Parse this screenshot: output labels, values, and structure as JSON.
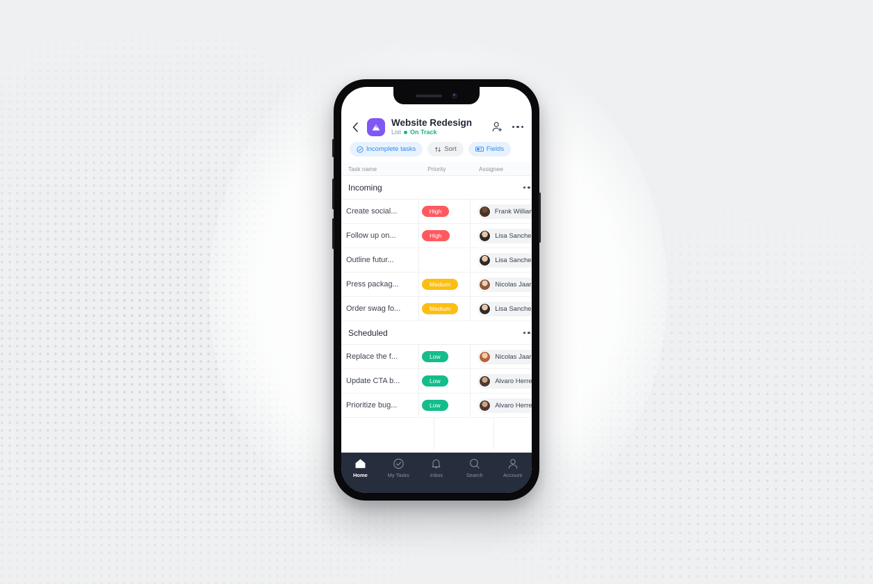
{
  "header": {
    "back_icon": "chevron-left-icon",
    "project_icon": "mountain-app-icon",
    "project_icon_color": "#8057f2",
    "title": "Website Redesign",
    "view_label": "List",
    "separator": "•",
    "status": "On Track",
    "status_color": "#19b57a",
    "invite_icon": "person-add-icon",
    "more_icon": "more-horizontal-icon"
  },
  "toolbar": {
    "chips": [
      {
        "label": "Incomplete tasks",
        "icon": "check-circle-icon",
        "style": "blue"
      },
      {
        "label": "Sort",
        "icon": "sort-arrows-icon",
        "style": "gray"
      },
      {
        "label": "Fields",
        "icon": "fields-icon",
        "style": "blue"
      }
    ]
  },
  "table": {
    "columns": [
      {
        "key": "task",
        "label": "Task name"
      },
      {
        "key": "priority",
        "label": "Priority"
      },
      {
        "key": "assignee",
        "label": "Assignee"
      }
    ],
    "groups": [
      {
        "name": "Incoming",
        "more_icon": "more-horizontal-icon",
        "rows": [
          {
            "task": "Create social...",
            "priority": "High",
            "priority_level": "high",
            "assignee": "Frank Williams",
            "avatar": "avatar-frank"
          },
          {
            "task": "Follow up on...",
            "priority": "High",
            "priority_level": "high",
            "assignee": "Lisa Sanchez",
            "avatar": "avatar-lisa"
          },
          {
            "task": "Outline futur...",
            "priority": "",
            "priority_level": "none",
            "assignee": "Lisa Sanchez",
            "avatar": "avatar-lisa"
          },
          {
            "task": "Press packag...",
            "priority": "Medium",
            "priority_level": "medium",
            "assignee": "Nicolas Jaar",
            "avatar": "avatar-nicolas"
          },
          {
            "task": "Order swag fo...",
            "priority": "Medium",
            "priority_level": "medium",
            "assignee": "Lisa Sanchez",
            "avatar": "avatar-lisa"
          }
        ]
      },
      {
        "name": "Scheduled",
        "more_icon": "more-horizontal-icon",
        "rows": [
          {
            "task": "Replace the f...",
            "priority": "Low",
            "priority_level": "low",
            "assignee": "Nicolas Jaar",
            "avatar": "avatar-nicolas"
          },
          {
            "task": "Update CTA b...",
            "priority": "Low",
            "priority_level": "low",
            "assignee": "Alvaro Herrera",
            "avatar": "avatar-alvaro"
          },
          {
            "task": "Prioritize bug...",
            "priority": "Low",
            "priority_level": "low",
            "assignee": "Alvaro Herrera",
            "avatar": "avatar-alvaro"
          }
        ]
      }
    ],
    "priority_colors": {
      "high": "#fc5a5f",
      "medium": "#fcbe11",
      "low": "#14bd8b"
    },
    "checkbox_icon": "check-circle-icon"
  },
  "bottom_nav": {
    "background": "#262d3c",
    "items": [
      {
        "label": "Home",
        "icon": "home-icon",
        "active": true
      },
      {
        "label": "My Tasks",
        "icon": "check-circle-icon",
        "active": false
      },
      {
        "label": "Inbox",
        "icon": "bell-icon",
        "active": false
      },
      {
        "label": "Search",
        "icon": "search-icon",
        "active": false
      },
      {
        "label": "Account",
        "icon": "person-icon",
        "active": false
      }
    ]
  }
}
